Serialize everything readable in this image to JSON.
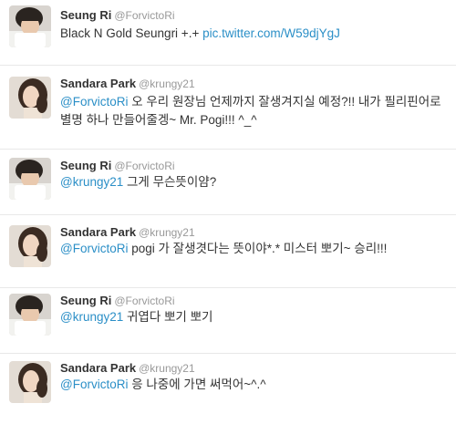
{
  "tweets": [
    {
      "name": "Seung Ri",
      "handle": "@ForvictoRi",
      "mention": "",
      "text": "Black N Gold Seungri +.+ ",
      "link": "pic.twitter.com/W59djYgJ",
      "avatar": "seungri-avatar"
    },
    {
      "name": "Sandara Park",
      "handle": "@krungy21",
      "mention": "@ForvictoRi",
      "text": " 오 우리 원장님 언제까지 잘생겨지실 예정?!! 내가 필리핀어로 별명 하나 만들어줄겡~ Mr. Pogi!!! ^_^",
      "link": "",
      "avatar": "sandara-avatar"
    },
    {
      "name": "Seung Ri",
      "handle": "@ForvictoRi",
      "mention": "@krungy21",
      "text": " 그게 무슨뜻이얌?",
      "link": "",
      "avatar": "seungri-avatar"
    },
    {
      "name": "Sandara Park",
      "handle": "@krungy21",
      "mention": "@ForvictoRi",
      "text": " pogi 가 잘생겻다는 뜻이야*.* 미스터 뽀기~ 승리!!!",
      "link": "",
      "avatar": "sandara-avatar"
    },
    {
      "name": "Seung Ri",
      "handle": "@ForvictoRi",
      "mention": "@krungy21",
      "text": " 귀엽다 뽀기 뽀기",
      "link": "",
      "avatar": "seungri-avatar"
    },
    {
      "name": "Sandara Park",
      "handle": "@krungy21",
      "mention": "@ForvictoRi",
      "text": " 응 나중에 가면 써먹어~^.^",
      "link": "",
      "avatar": "sandara-avatar"
    }
  ],
  "colors": {
    "link": "#2b8fc7",
    "name": "#333333",
    "handle": "#999999"
  }
}
